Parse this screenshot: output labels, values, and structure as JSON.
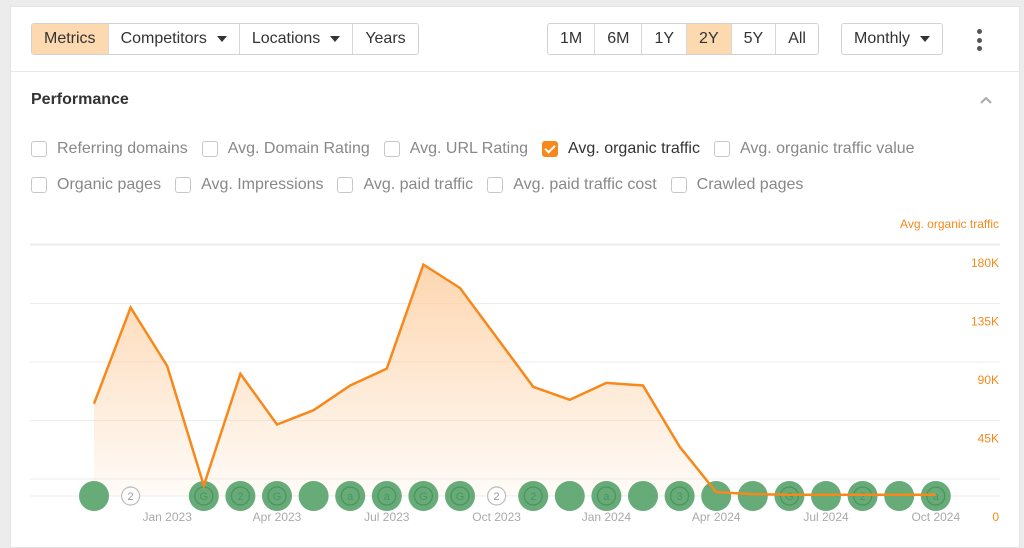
{
  "toolbar": {
    "left_tabs": [
      {
        "label": "Metrics",
        "active": true,
        "dropdown": false
      },
      {
        "label": "Competitors",
        "active": false,
        "dropdown": true
      },
      {
        "label": "Locations",
        "active": false,
        "dropdown": true
      },
      {
        "label": "Years",
        "active": false,
        "dropdown": false
      }
    ],
    "ranges": [
      {
        "label": "1M",
        "active": false
      },
      {
        "label": "6M",
        "active": false
      },
      {
        "label": "1Y",
        "active": false
      },
      {
        "label": "2Y",
        "active": true
      },
      {
        "label": "5Y",
        "active": false
      },
      {
        "label": "All",
        "active": false
      }
    ],
    "interval": "Monthly"
  },
  "section": {
    "title": "Performance",
    "metrics_row1": [
      {
        "label": "Referring domains",
        "checked": false
      },
      {
        "label": "Avg. Domain Rating",
        "checked": false
      },
      {
        "label": "Avg. URL Rating",
        "checked": false
      },
      {
        "label": "Avg. organic traffic",
        "checked": true
      },
      {
        "label": "Avg. organic traffic value",
        "checked": false
      }
    ],
    "metrics_row2": [
      {
        "label": "Organic pages",
        "checked": false
      },
      {
        "label": "Avg. Impressions",
        "checked": false
      },
      {
        "label": "Avg. paid traffic",
        "checked": false
      },
      {
        "label": "Avg. paid traffic cost",
        "checked": false
      },
      {
        "label": "Crawled pages",
        "checked": false
      }
    ]
  },
  "colors": {
    "accent": "#f7881b",
    "marker": "#5aa46e",
    "active_bg": "#fdd9b0"
  },
  "chart_data": {
    "type": "area",
    "title": "",
    "series_label": "Avg. organic traffic",
    "xlabel": "",
    "ylabel": "Avg. organic traffic",
    "ylim": [
      0,
      180000
    ],
    "yticks": [
      {
        "value": 0,
        "label": "0"
      },
      {
        "value": 45000,
        "label": "45K"
      },
      {
        "value": 90000,
        "label": "90K"
      },
      {
        "value": 135000,
        "label": "135K"
      },
      {
        "value": 180000,
        "label": "180K"
      }
    ],
    "x": [
      "Nov 2022",
      "Dec 2022",
      "Jan 2023",
      "Feb 2023",
      "Mar 2023",
      "Apr 2023",
      "May 2023",
      "Jun 2023",
      "Jul 2023",
      "Aug 2023",
      "Sep 2023",
      "Oct 2023",
      "Nov 2023",
      "Dec 2023",
      "Jan 2024",
      "Feb 2024",
      "Mar 2024",
      "Apr 2024",
      "May 2024",
      "Jun 2024",
      "Jul 2024",
      "Aug 2024",
      "Sep 2024",
      "Oct 2024"
    ],
    "xtick_labels": [
      {
        "index": 2,
        "label": "Jan 2023"
      },
      {
        "index": 5,
        "label": "Apr 2023"
      },
      {
        "index": 8,
        "label": "Jul 2023"
      },
      {
        "index": 11,
        "label": "Oct 2023"
      },
      {
        "index": 14,
        "label": "Jan 2024"
      },
      {
        "index": 17,
        "label": "Apr 2024"
      },
      {
        "index": 20,
        "label": "Jul 2024"
      },
      {
        "index": 23,
        "label": "Oct 2024"
      }
    ],
    "values": [
      71000,
      145000,
      100000,
      8000,
      94000,
      55000,
      66000,
      85000,
      98000,
      178000,
      160000,
      122000,
      84000,
      74000,
      87000,
      85000,
      38000,
      3000,
      1500,
      1000,
      1000,
      1000,
      1000,
      1000
    ],
    "annotations": [
      {
        "month": "Nov 2022",
        "type": "filled",
        "glyph": ""
      },
      {
        "month": "Dec 2022",
        "type": "outline",
        "glyph": "2"
      },
      {
        "month": "Feb 2023",
        "type": "filled",
        "glyph": "G"
      },
      {
        "month": "Mar 2023",
        "type": "filled",
        "glyph": "2"
      },
      {
        "month": "Apr 2023",
        "type": "filled",
        "glyph": "G"
      },
      {
        "month": "May 2023",
        "type": "filled",
        "glyph": ""
      },
      {
        "month": "Jun 2023",
        "type": "filled",
        "glyph": "a"
      },
      {
        "month": "Jul 2023",
        "type": "filled",
        "glyph": "a"
      },
      {
        "month": "Aug 2023",
        "type": "filled",
        "glyph": "G"
      },
      {
        "month": "Sep 2023",
        "type": "filled",
        "glyph": "G"
      },
      {
        "month": "Oct 2023",
        "type": "outline",
        "glyph": "2"
      },
      {
        "month": "Nov 2023",
        "type": "filled",
        "glyph": "2"
      },
      {
        "month": "Dec 2023",
        "type": "filled",
        "glyph": ""
      },
      {
        "month": "Jan 2024",
        "type": "filled",
        "glyph": "a"
      },
      {
        "month": "Feb 2024",
        "type": "filled",
        "glyph": ""
      },
      {
        "month": "Mar 2024",
        "type": "filled",
        "glyph": "3"
      },
      {
        "month": "Apr 2024",
        "type": "filled",
        "glyph": ""
      },
      {
        "month": "May 2024",
        "type": "filled",
        "glyph": ""
      },
      {
        "month": "Jun 2024",
        "type": "filled",
        "glyph": "G"
      },
      {
        "month": "Jul 2024",
        "type": "filled",
        "glyph": ""
      },
      {
        "month": "Aug 2024",
        "type": "filled",
        "glyph": "2"
      },
      {
        "month": "Sep 2024",
        "type": "filled",
        "glyph": ""
      },
      {
        "month": "Oct 2024",
        "type": "filled",
        "glyph": "a"
      }
    ],
    "grid": true,
    "legend": "top-right"
  }
}
